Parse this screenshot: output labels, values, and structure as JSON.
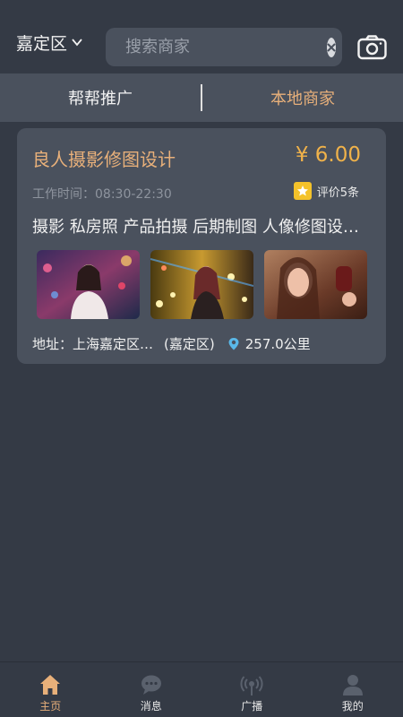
{
  "header": {
    "city": "嘉定区",
    "search_placeholder": "搜索商家"
  },
  "tabs": [
    {
      "label": "帮帮推广"
    },
    {
      "label": "本地商家"
    }
  ],
  "merchant": {
    "name": "良人摄影修图设计",
    "price": "¥ 6.00",
    "hours": "工作时间：08:30-22:30",
    "rating": "评价5条",
    "tags": "摄影 私房照 产品拍摄 后期制图 人像修图设计 美工",
    "address": "地址：上海嘉定区…",
    "district": "(嘉定区)",
    "distance": "257.0公里"
  },
  "nav": [
    {
      "label": "主页",
      "icon": "home-icon"
    },
    {
      "label": "消息",
      "icon": "chat-icon"
    },
    {
      "label": "广播",
      "icon": "broadcast-icon"
    },
    {
      "label": "我的",
      "icon": "user-icon"
    }
  ],
  "colors": {
    "background": "#343a45",
    "panel": "#4a515d",
    "accent": "#e8b07a",
    "price": "#f0b24a"
  }
}
